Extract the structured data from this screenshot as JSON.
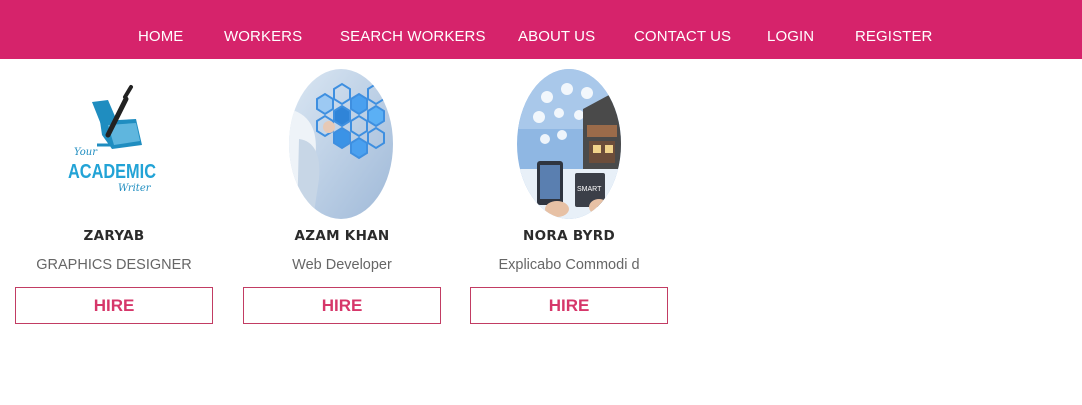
{
  "nav": {
    "items": [
      {
        "label": "HOME"
      },
      {
        "label": "WORKERS"
      },
      {
        "label": "SEARCH WORKERS"
      },
      {
        "label": "ABOUT US"
      },
      {
        "label": "CONTACT US"
      },
      {
        "label": "LOGIN"
      },
      {
        "label": "REGISTER"
      }
    ]
  },
  "workers": [
    {
      "name": "ZARYAB",
      "role": "GRAPHICS DESIGNER",
      "hire_label": "HIRE",
      "logo": {
        "line1": "Your",
        "line2": "ACADEMIC",
        "line3": "Writer"
      }
    },
    {
      "name": "AZAM KHAN",
      "role": "Web Developer",
      "hire_label": "HIRE"
    },
    {
      "name": "NORA BYRD",
      "role": "Explicabo Commodi d",
      "hire_label": "HIRE"
    }
  ],
  "colors": {
    "brand": "#d6236b",
    "button_border": "#c23c63",
    "button_text": "#d6376a",
    "name_text": "#2b2b2b",
    "role_text": "#666666"
  }
}
